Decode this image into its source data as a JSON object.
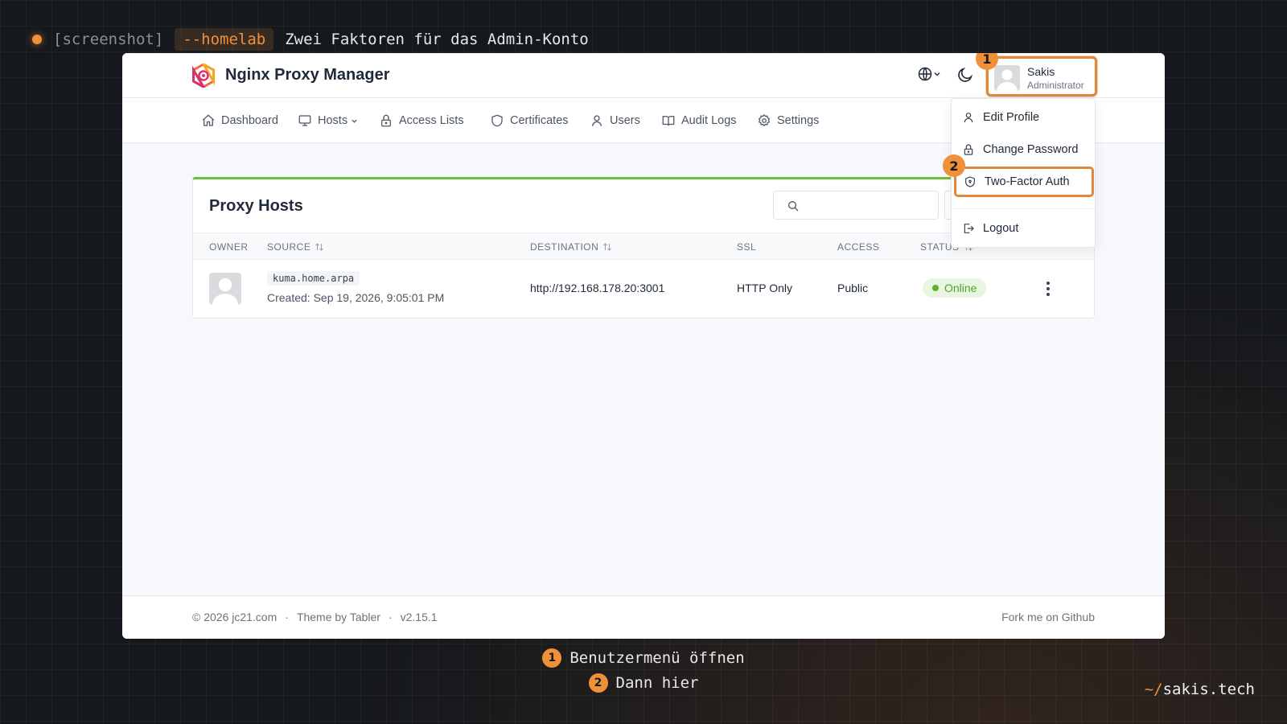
{
  "caption": {
    "tag1": "[screenshot]",
    "tag2": "--homelab",
    "title": "Zwei Faktoren für das Admin-Konto"
  },
  "app": {
    "brand": "Nginx Proxy Manager",
    "user": {
      "name": "Sakis",
      "role": "Administrator"
    },
    "nav": [
      "Dashboard",
      "Hosts",
      "Access Lists",
      "Certificates",
      "Users",
      "Audit Logs",
      "Settings"
    ],
    "card": {
      "title": "Proxy Hosts",
      "columns": [
        "OWNER",
        "SOURCE",
        "DESTINATION",
        "SSL",
        "ACCESS",
        "STATUS"
      ],
      "rows": [
        {
          "source": "kuma.home.arpa",
          "created": "Created: Sep 19, 2026, 9:05:01 PM",
          "destination": "http://192.168.178.20:3001",
          "ssl": "HTTP Only",
          "access": "Public",
          "status": "Online"
        }
      ]
    },
    "dropdown": [
      "Edit Profile",
      "Change Password",
      "Two-Factor Auth",
      "Logout"
    ],
    "footer": {
      "copyright": "© 2026 jc21.com",
      "sep": "·",
      "theme": "Theme by Tabler",
      "version": "v2.15.1",
      "fork": "Fork me on Github"
    }
  },
  "badges": [
    "1",
    "2"
  ],
  "legend": [
    {
      "num": "1",
      "text": "Benutzermenü öffnen"
    },
    {
      "num": "2",
      "text": "Dann hier"
    }
  ],
  "signature": {
    "tilde": "~/",
    "site": "sakis.tech"
  },
  "colors": {
    "accent": "#ef9139",
    "online": "#4fa52a",
    "card_top": "#6cbf3a"
  }
}
